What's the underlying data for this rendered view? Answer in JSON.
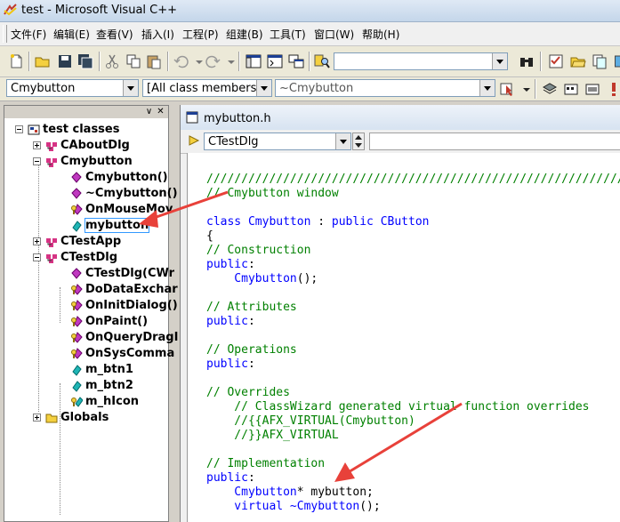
{
  "window": {
    "title": "test - Microsoft Visual C++"
  },
  "menu": [
    "文件(F)",
    "编辑(E)",
    "查看(V)",
    "插入(I)",
    "工程(P)",
    "组建(B)",
    "工具(T)",
    "窗口(W)",
    "帮助(H)"
  ],
  "toolbar2": {
    "class_combo": "Cmybutton",
    "filter_combo": "[All class members]",
    "member_combo": "~Cmybutton"
  },
  "workspace": {
    "tree": [
      {
        "label": "test classes",
        "level": 0,
        "icon": "project-icon",
        "expander": "minus"
      },
      {
        "label": "CAboutDlg",
        "level": 1,
        "icon": "class-icon",
        "expander": "plus"
      },
      {
        "label": "Cmybutton",
        "level": 1,
        "icon": "class-icon",
        "expander": "minus"
      },
      {
        "label": "Cmybutton()",
        "level": 2,
        "icon": "method-icon"
      },
      {
        "label": "~Cmybutton()",
        "level": 2,
        "icon": "method-icon"
      },
      {
        "label": "OnMouseMov",
        "level": 2,
        "icon": "protected-method-icon"
      },
      {
        "label": "mybutton",
        "level": 2,
        "icon": "member-icon",
        "selected": true
      },
      {
        "label": "CTestApp",
        "level": 1,
        "icon": "class-icon",
        "expander": "plus"
      },
      {
        "label": "CTestDlg",
        "level": 1,
        "icon": "class-icon",
        "expander": "minus"
      },
      {
        "label": "CTestDlg(CWr",
        "level": 2,
        "icon": "method-icon"
      },
      {
        "label": "DoDataExchar",
        "level": 2,
        "icon": "protected-method-icon"
      },
      {
        "label": "OnInitDialog()",
        "level": 2,
        "icon": "protected-method-icon"
      },
      {
        "label": "OnPaint()",
        "level": 2,
        "icon": "protected-method-icon"
      },
      {
        "label": "OnQueryDragI",
        "level": 2,
        "icon": "protected-method-icon"
      },
      {
        "label": "OnSysComma",
        "level": 2,
        "icon": "protected-method-icon"
      },
      {
        "label": "m_btn1",
        "level": 2,
        "icon": "member-icon"
      },
      {
        "label": "m_btn2",
        "level": 2,
        "icon": "member-icon"
      },
      {
        "label": "m_hIcon",
        "level": 2,
        "icon": "protected-member-icon"
      },
      {
        "label": "Globals",
        "level": 1,
        "icon": "folder-icon",
        "expander": "plus"
      }
    ]
  },
  "editor": {
    "filename": "mybutton.h",
    "class_combo": "CTestDlg",
    "lines": [
      [
        {
          "t": "/////////////////////////////////////////////////////////////////////////////",
          "c": "cm"
        }
      ],
      [
        {
          "t": "// Cmybutton window",
          "c": "cm"
        }
      ],
      [],
      [
        {
          "t": "class ",
          "c": "kw"
        },
        {
          "t": "Cmybutton",
          "c": "kw"
        },
        {
          "t": " : ",
          "c": "tx"
        },
        {
          "t": "public ",
          "c": "kw"
        },
        {
          "t": "CButton",
          "c": "kw"
        }
      ],
      [
        {
          "t": "{",
          "c": "tx"
        }
      ],
      [
        {
          "t": "// Construction",
          "c": "cm"
        }
      ],
      [
        {
          "t": "public",
          "c": "kw"
        },
        {
          "t": ":",
          "c": "tx"
        }
      ],
      [
        {
          "t": "    Cmybutton",
          "c": "kw"
        },
        {
          "t": "();",
          "c": "tx"
        }
      ],
      [],
      [
        {
          "t": "// Attributes",
          "c": "cm"
        }
      ],
      [
        {
          "t": "public",
          "c": "kw"
        },
        {
          "t": ":",
          "c": "tx"
        }
      ],
      [],
      [
        {
          "t": "// Operations",
          "c": "cm"
        }
      ],
      [
        {
          "t": "public",
          "c": "kw"
        },
        {
          "t": ":",
          "c": "tx"
        }
      ],
      [],
      [
        {
          "t": "// Overrides",
          "c": "cm"
        }
      ],
      [
        {
          "t": "    // ClassWizard generated virtual function overrides",
          "c": "cm"
        }
      ],
      [
        {
          "t": "    //{{AFX_VIRTUAL(Cmybutton)",
          "c": "cm"
        }
      ],
      [
        {
          "t": "    //}}AFX_VIRTUAL",
          "c": "cm"
        }
      ],
      [],
      [
        {
          "t": "// Implementation",
          "c": "cm"
        }
      ],
      [
        {
          "t": "public",
          "c": "kw"
        },
        {
          "t": ":",
          "c": "tx"
        }
      ],
      [
        {
          "t": "    Cmybutton",
          "c": "kw"
        },
        {
          "t": "* mybutton;",
          "c": "tx"
        }
      ],
      [
        {
          "t": "    virtual ",
          "c": "kw"
        },
        {
          "t": "~Cmybutton",
          "c": "kw"
        },
        {
          "t": "();",
          "c": "tx"
        }
      ]
    ]
  },
  "colors": {
    "keyword": "#0000ff",
    "comment": "#008000",
    "annotation_arrow": "#e8413a"
  }
}
